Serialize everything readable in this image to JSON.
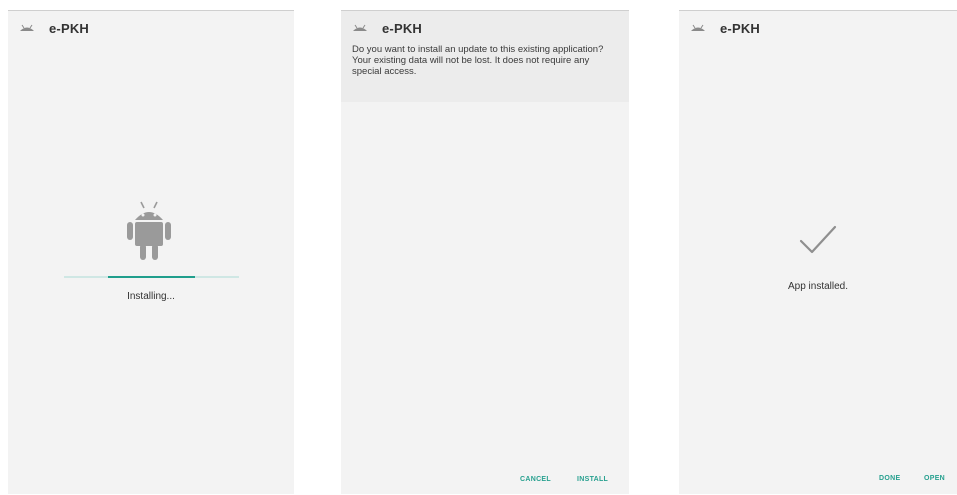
{
  "screens": [
    {
      "app_name": "e-PKH",
      "app_icon": "android-app-icon",
      "status_text": "Installing...",
      "progress": 0.5,
      "illustration": "android-robot-icon"
    },
    {
      "app_name": "e-PKH",
      "app_icon": "android-app-icon",
      "message": "Do you want to install an update to this existing application? Your existing data will not be lost. It does not require any special access.",
      "buttons": {
        "cancel": "CANCEL",
        "install": "INSTALL"
      }
    },
    {
      "app_name": "e-PKH",
      "app_icon": "android-app-icon",
      "status_text": "App installed.",
      "illustration": "checkmark-icon",
      "buttons": {
        "done": "DONE",
        "open": "OPEN"
      }
    }
  ],
  "colors": {
    "accent": "#1f9e8c",
    "background": "#f3f3f3",
    "header": "#ececec"
  }
}
